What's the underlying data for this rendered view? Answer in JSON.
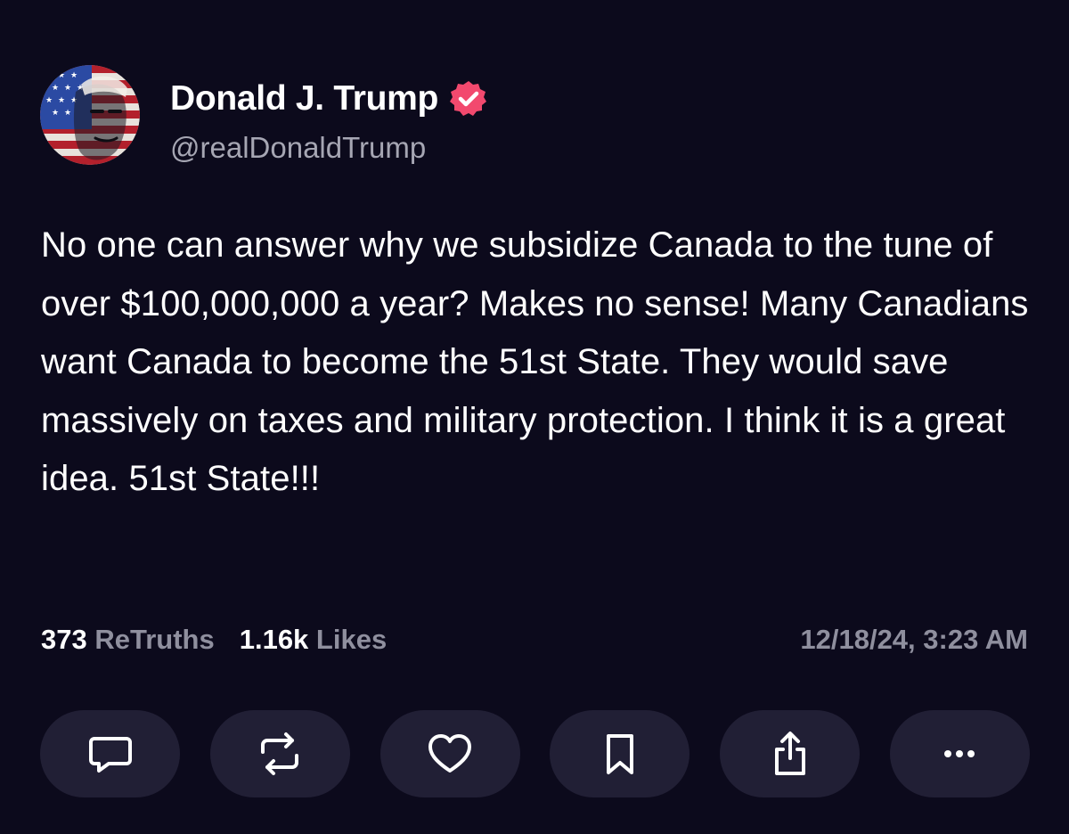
{
  "user": {
    "display_name": "Donald J. Trump",
    "handle": "@realDonaldTrump",
    "verified": true,
    "verified_badge_color": "#f2496e"
  },
  "post": {
    "text": "No one can answer why we subsidize Canada to the tune of over $100,000,000 a year? Makes no sense! Many Canadians want Canada to become the 51st State. They would save massively on taxes and military protection. I think it is a great idea. 51st State!!!"
  },
  "stats": {
    "retruths_count": "373",
    "retruths_label": "ReTruths",
    "likes_count": "1.16k",
    "likes_label": "Likes",
    "timestamp": "12/18/24, 3:23 AM"
  },
  "actions": [
    {
      "name": "reply",
      "icon": "speech-bubble-icon"
    },
    {
      "name": "retruth",
      "icon": "repost-arrows-icon"
    },
    {
      "name": "like",
      "icon": "heart-icon"
    },
    {
      "name": "bookmark",
      "icon": "bookmark-icon"
    },
    {
      "name": "share",
      "icon": "share-icon"
    },
    {
      "name": "more",
      "icon": "ellipsis-icon"
    }
  ],
  "colors": {
    "background": "#0c0a1c",
    "button_background": "#211f35",
    "secondary_text": "#8f8f9e",
    "primary_text": "#ffffff"
  }
}
